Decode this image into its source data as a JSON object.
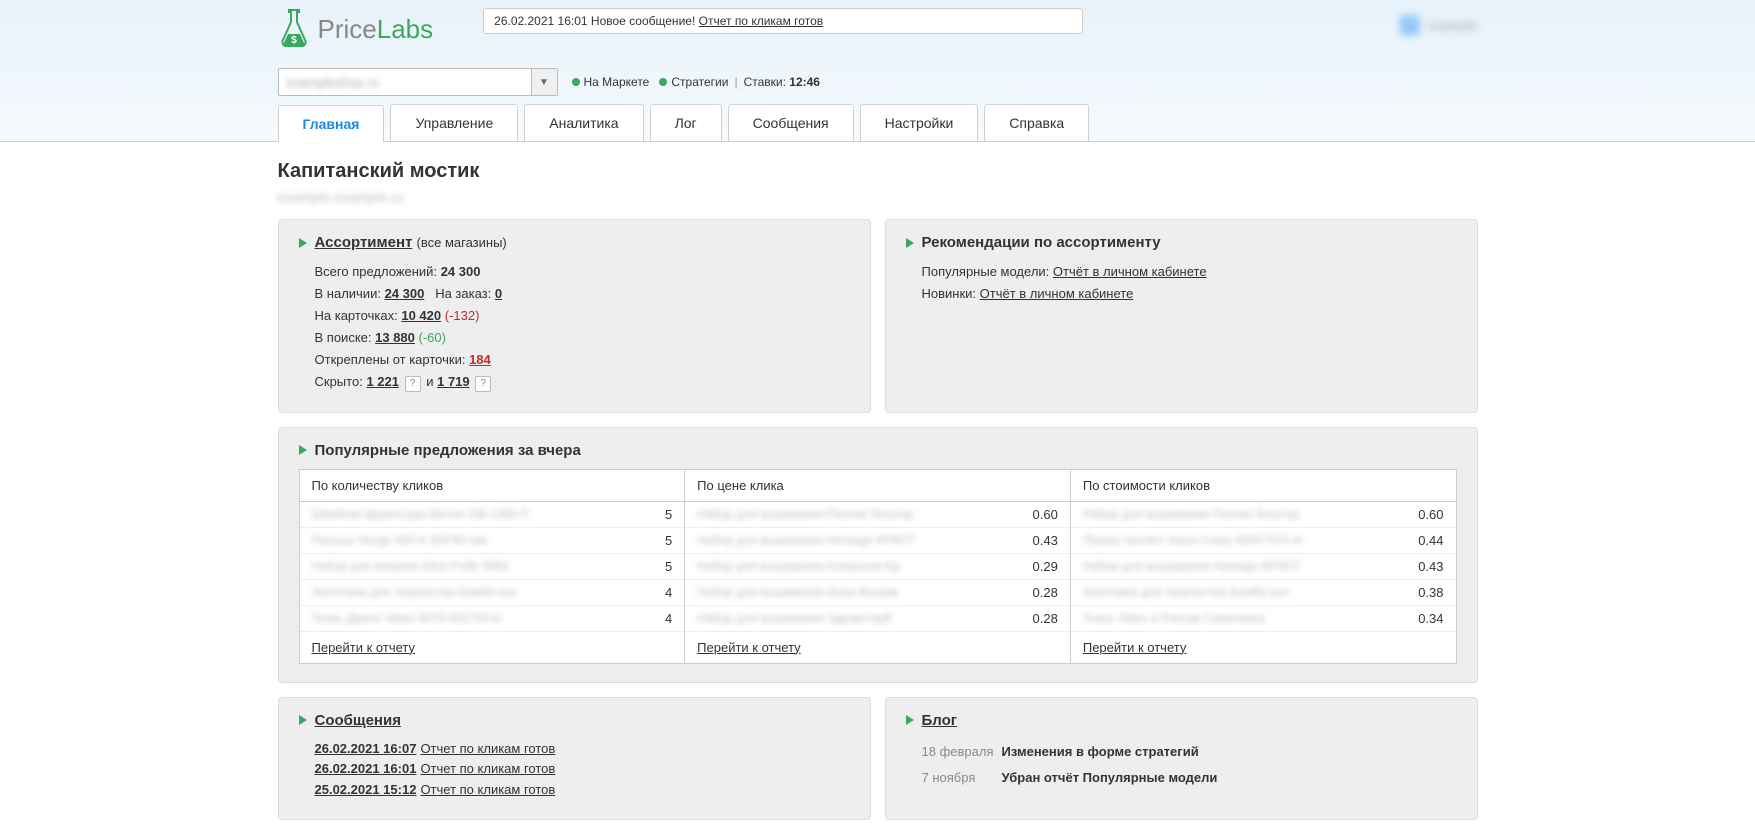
{
  "notification": {
    "date": "26.02.2021 16:01",
    "label": "Новое сообщение!",
    "link": "Отчет по кликам готов"
  },
  "logo": {
    "a": "Price",
    "b": "Labs"
  },
  "user": {
    "name": "example"
  },
  "status": {
    "market": "На Маркете",
    "strategy": "Стратегии",
    "bids_label": "Ставки:",
    "bids_time": "12:46"
  },
  "tabs": [
    "Главная",
    "Управление",
    "Аналитика",
    "Лог",
    "Сообщения",
    "Настройки",
    "Справка"
  ],
  "page_title": "Капитанский мостик",
  "subtext": "example.example.ru",
  "assort": {
    "title": "Ассортимент",
    "suffix": "(все магазины)",
    "total_label": "Всего предложений:",
    "total": "24 300",
    "instock_label": "В наличии:",
    "instock": "24 300",
    "order_label": "На заказ:",
    "order": "0",
    "cards_label": "На карточках:",
    "cards": "10 420",
    "cards_delta": "(-132)",
    "search_label": "В поиске:",
    "search": "13 880",
    "search_delta": "(-60)",
    "detached_label": "Откреплены от карточки:",
    "detached": "184",
    "hidden_label": "Скрыто:",
    "hidden1": "1 221",
    "and": "и",
    "hidden2": "1 719"
  },
  "recs": {
    "title": "Рекомендации по ассортименту",
    "pop_label": "Популярные модели:",
    "pop_link": "Отчёт в личном кабинете",
    "new_label": "Новинки:",
    "new_link": "Отчёт в личном кабинете"
  },
  "popular": {
    "title": "Популярные предложения за вчера",
    "cols": [
      "По количеству кликов",
      "По цене клика",
      "По стоимости кликов"
    ],
    "col1": [
      {
        "v": "5"
      },
      {
        "v": "5"
      },
      {
        "v": "5"
      },
      {
        "v": "4"
      },
      {
        "v": "4"
      }
    ],
    "col2": [
      {
        "v": "0.60"
      },
      {
        "v": "0.43"
      },
      {
        "v": "0.29"
      },
      {
        "v": "0.28"
      },
      {
        "v": "0.28"
      }
    ],
    "col3": [
      {
        "v": "0.60"
      },
      {
        "v": "0.44"
      },
      {
        "v": "0.43"
      },
      {
        "v": "0.38"
      },
      {
        "v": "0.34"
      }
    ],
    "foot": "Перейти к отчету"
  },
  "messages": {
    "title": "Сообщения",
    "items": [
      {
        "d": "26.02.2021 16:07",
        "t": "Отчет по кликам готов"
      },
      {
        "d": "26.02.2021 16:01",
        "t": "Отчет по кликам готов"
      },
      {
        "d": "25.02.2021 15:12",
        "t": "Отчет по кликам готов"
      }
    ]
  },
  "blog": {
    "title": "Блог",
    "items": [
      {
        "d": "18 февраля",
        "t": "Изменения в форме стратегий"
      },
      {
        "d": "7 ноября",
        "t": "Убран отчёт Популярные модели"
      }
    ]
  }
}
